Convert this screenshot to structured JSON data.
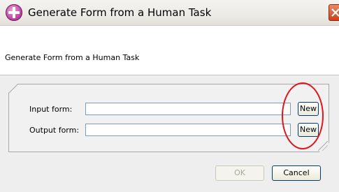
{
  "window": {
    "title": "Generate Form from a Human Task",
    "app_icon": "plus-circle-icon",
    "close_icon": "close-icon"
  },
  "banner": {
    "description": "Generate Form from a Human Task"
  },
  "form": {
    "input_label": "Input form:",
    "input_value": "",
    "input_new_label": "New",
    "output_label": "Output form:",
    "output_value": "",
    "output_new_label": "New"
  },
  "buttons": {
    "ok_label": "OK",
    "ok_enabled": false,
    "cancel_label": "Cancel"
  },
  "colors": {
    "annotation": "#e0141c",
    "input_border": "#7f9db9",
    "button_border": "#003c74"
  }
}
